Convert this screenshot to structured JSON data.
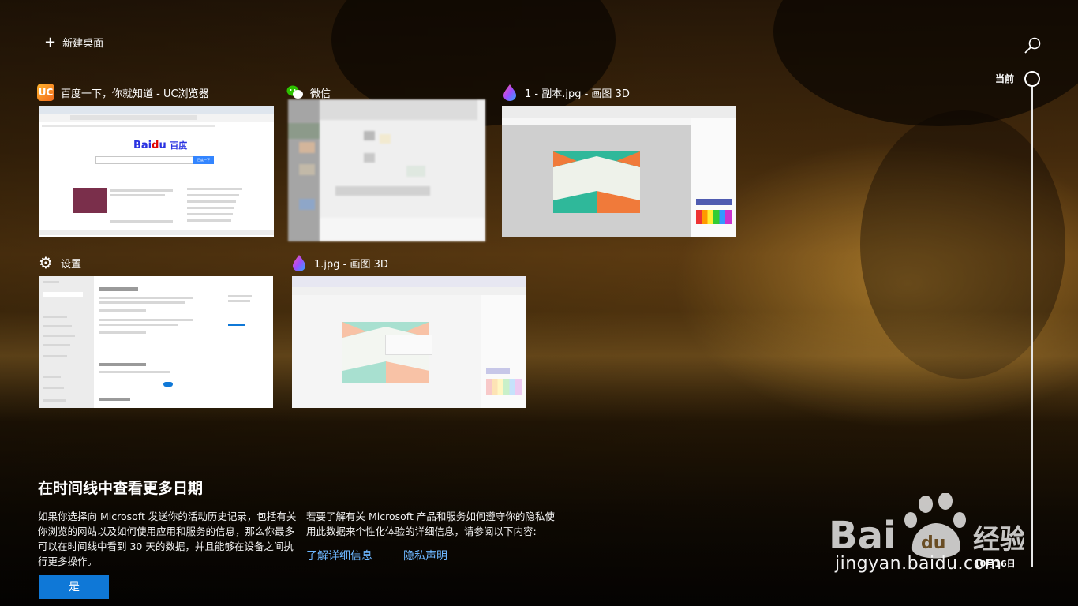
{
  "toolbar": {
    "new_desktop_label": "新建桌面"
  },
  "cards": [
    {
      "title": "百度一下，你就知道 - UC浏览器",
      "icon": "uc-browser-icon"
    },
    {
      "title": "微信",
      "icon": "wechat-icon"
    },
    {
      "title": "1 - 副本.jpg - 画图 3D",
      "icon": "paint3d-icon"
    },
    {
      "title": "设置",
      "icon": "settings-gear-icon"
    },
    {
      "title": "1.jpg - 画图 3D",
      "icon": "paint3d-icon"
    }
  ],
  "baidu": {
    "logo_text": "百度",
    "search_button": "百度一下"
  },
  "timeline": {
    "current_label": "当前",
    "date_label": "10月16日"
  },
  "more": {
    "title": "在时间线中查看更多日期",
    "desc_left": "如果你选择向 Microsoft 发送你的活动历史记录，包括有关你浏览的网站以及如何使用应用和服务的信息，那么你最多可以在时间线中看到 30 天的数据，并且能够在设备之间执行更多操作。",
    "desc_right": "若要了解有关 Microsoft 产品和服务如何遵守你的隐私使用此数据来个性化体验的详细信息，请参阅以下内容:",
    "link_learn": "了解详细信息",
    "link_privacy": "隐私声明",
    "yes_button": "是"
  },
  "watermark": {
    "text": "jingyan.baidu.com"
  },
  "colors": {
    "accent": "#0f78d7",
    "link": "#6db7ff"
  }
}
